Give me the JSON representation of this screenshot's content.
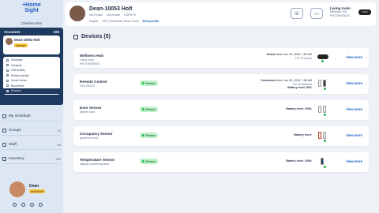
{
  "brand": {
    "logo_line1": "+Home",
    "logo_line2": "Sight",
    "account": "Chelsea Dev"
  },
  "sidebar": {
    "accounts_label": "Accounts",
    "accounts_count": "105",
    "current": {
      "name": "Dean-10053 Holt",
      "badge": "Manager"
    },
    "submenu": [
      "Schedule",
      "Contacts",
      "Call Activity",
      "Motion Activity",
      "Smart Home",
      "Biometrics",
      "Devices"
    ],
    "nav": [
      {
        "label": "My Schedule",
        "count": ""
      },
      {
        "label": "Groups",
        "count": "11"
      },
      {
        "label": "Staff",
        "count": "89"
      },
      {
        "label": "Inventory",
        "count": "255"
      }
    ],
    "user": {
      "name": "Dean",
      "badge": "Staff Admin"
    }
  },
  "header": {
    "name": "Dean-10053 Holt",
    "meta": [
      "Not Known",
      "Not Known",
      "USER:70"
    ],
    "lang": "English",
    "tz": "GMT (Greenwich Mean Time)",
    "edit": "Edit profile",
    "hub_title": "Living room",
    "hub_sub1": "Wellness Hub",
    "hub_sub2": "HH7230076033"
  },
  "devices": {
    "title": "Devices (5)",
    "view_label": "View more",
    "items": [
      {
        "name": "Wellness Hub",
        "sub": "Living room",
        "sub2": "HH7230076033",
        "paired": "",
        "status_a": "Online",
        "status_b": "since Jun 18, 2026, 7:59 AM",
        "status_c": "For 12 Hours",
        "battery": ""
      },
      {
        "name": "Remote Control",
        "sub": "2017203237",
        "sub2": "",
        "paired": "Paired",
        "status_a": "Connected",
        "status_b": "since Jun 18, 2026, 7:59 AM",
        "status_c": "For 26 Minutes",
        "battery": "Battery level: 52%"
      },
      {
        "name": "Door Sensor",
        "sub": "kitchen door",
        "sub2": "",
        "paired": "Paired",
        "status_a": "",
        "status_b": "",
        "status_c": "",
        "battery": "Battery level: 100%"
      },
      {
        "name": "Occupancy Sensor",
        "sub": "guestroom bed",
        "sub2": "",
        "paired": "Paired",
        "status_a": "",
        "status_b": "",
        "status_c": "",
        "battery": "Battery level:"
      },
      {
        "name": "Temperature Sensor",
        "sub": "hallway countertop/area",
        "sub2": "",
        "paired": "Paired",
        "status_a": "",
        "status_b": "",
        "status_c": "",
        "battery": "Battery level: 100%"
      }
    ]
  },
  "colors": {
    "accent": "#1e5fbf",
    "sidebar_dark": "#1f3a60",
    "paired_bg": "#bff0c9",
    "ok": "#2bb24c"
  }
}
